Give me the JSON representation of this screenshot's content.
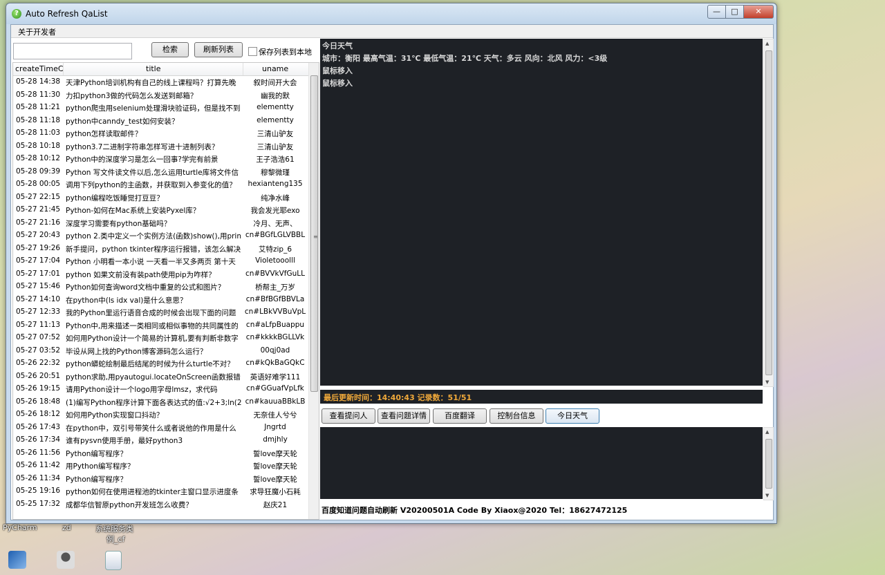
{
  "desktop": {
    "icon_labels": [
      "PyCharm",
      "zd",
      "系统服务类",
      "例_cf"
    ]
  },
  "window": {
    "title": "Auto Refresh QaList",
    "minimize": "—",
    "maximize": "□",
    "close": "✕"
  },
  "menu": {
    "about": "关于开发者"
  },
  "toolbar": {
    "search_value": "",
    "search_button": "检索",
    "refresh_button": "刷新列表",
    "save_checkbox_label": "保存列表到本地",
    "save_checked": false
  },
  "list": {
    "columns": [
      "createTimeC",
      "title",
      "uname"
    ],
    "rows": [
      {
        "time": "05-28 14:38",
        "title": "天津Python培训机构有自己的线上课程吗？打算先晚",
        "user": "叙时间开大会"
      },
      {
        "time": "05-28 11:30",
        "title": "力扣python3做的代码怎么发送到邮箱？",
        "user": "幽我的默"
      },
      {
        "time": "05-28 11:21",
        "title": "python爬虫用selenium处理滑块验证码，但是找不到",
        "user": "elementty"
      },
      {
        "time": "05-28 11:18",
        "title": "python中canndy_test如何安装？",
        "user": "elementty"
      },
      {
        "time": "05-28 11:03",
        "title": "python怎样读取邮件？",
        "user": "三清山驴友"
      },
      {
        "time": "05-28 10:18",
        "title": "python3.7二进制字符串怎样写进十进制列表？",
        "user": "三清山驴友"
      },
      {
        "time": "05-28 10:12",
        "title": "        Python中的深度学习是怎么一回事?学完有前景",
        "user": "王子浩浩61"
      },
      {
        "time": "05-28 09:39",
        "title": "Python 写文件读文件以后,怎么运用turtle库将文件信",
        "user": "穆黎微瑾"
      },
      {
        "time": "05-28 00:05",
        "title": "调用下列python的主函数，并获取到入参变化的值？",
        "user": "hexianteng135"
      },
      {
        "time": "05-27 22:15",
        "title": "python编程吃饭睡觉打豆豆？",
        "user": "纯净水峰"
      },
      {
        "time": "05-27 21:45",
        "title": "Python-如何在Mac系统上安装Pyxel库？",
        "user": "我会发光耶exo"
      },
      {
        "time": "05-27 21:16",
        "title": "深度学习需要有python基础吗？",
        "user": "冷月、无声、"
      },
      {
        "time": "05-27 20:43",
        "title": "python 2.类中定义一个实例方法(函数)show(),用print",
        "user": "cn#BGfLGLVBBL"
      },
      {
        "time": "05-27 19:26",
        "title": "新手提问，python tkinter程序运行报错，该怎么解决",
        "user": "艾特zip_6"
      },
      {
        "time": "05-27 17:04",
        "title": "Python 小明看一本小说 一天看一半又多两页 第十天",
        "user": "Violetooolll"
      },
      {
        "time": "05-27 17:01",
        "title": "python 如果文前没有装path使用pip为咋样？",
        "user": "cn#BVVkVfGuLL"
      },
      {
        "time": "05-27 15:46",
        "title": "Python如何查询word文档中重复的公式和图片？",
        "user": "桥帮主_万岁"
      },
      {
        "time": "05-27 14:10",
        "title": "在python中(ls idx val)是什么意思？",
        "user": "cn#BfBGfBBVLa"
      },
      {
        "time": "05-27 12:33",
        "title": "我的Python里运行语音合成的时候会出现下面的问题",
        "user": "cn#LBkVVBuVpL"
      },
      {
        "time": "05-27 11:13",
        "title": "Python中,用来描述一类相同或相似事物的共同属性的",
        "user": "cn#aLfpBuappu"
      },
      {
        "time": "05-27 07:52",
        "title": "如何用Python设计一个简易的计算机,要有判断非数字",
        "user": "cn#kkkkBGLLVk"
      },
      {
        "time": "05-27 03:52",
        "title": "毕设从网上找的Python博客源码怎么运行？",
        "user": "00qj0ad"
      },
      {
        "time": "05-26 22:32",
        "title": "python蟒蛇绘制最后结尾的时候为什么turtle不对？",
        "user": "cn#kQkBaGQkC"
      },
      {
        "time": "05-26 20:51",
        "title": "python求助,用pyautogui.locateOnScreen函数报错",
        "user": "英语好难学111"
      },
      {
        "time": "05-26 19:15",
        "title": "请用Python设计一个logo用字母lmsz，求代码",
        "user": "cn#GGuafVpLfk"
      },
      {
        "time": "05-26 18:48",
        "title": "(1)编写Python程序计算下面各表达式的值:√2+3;ln(2",
        "user": "cn#kauuaBBkLB"
      },
      {
        "time": "05-26 18:12",
        "title": "如何用Python实现窗口抖动？",
        "user": "无奈佳人兮兮"
      },
      {
        "time": "05-26 17:43",
        "title": "在python中，双引号带笑什么或者说他的作用是什么",
        "user": "Jngrtd"
      },
      {
        "time": "05-26 17:34",
        "title": "谁有pysvn使用手册，最好python3",
        "user": "dmjhly"
      },
      {
        "time": "05-26 11:56",
        "title": "Python编写程序？",
        "user": "誓love摩天轮"
      },
      {
        "time": "05-26 11:42",
        "title": "用Python编写程序？",
        "user": "誓love摩天轮"
      },
      {
        "time": "05-26 11:34",
        "title": "Python编写程序？",
        "user": "誓love摩天轮"
      },
      {
        "time": "05-25 19:16",
        "title": "python如何在使用进程池的tkinter主窗口显示进度条",
        "user": "求导狂魔小石耗"
      },
      {
        "time": "05-25 17:32",
        "title": "成都华信智原python开发班怎么收费？",
        "user": "赵庆21"
      }
    ]
  },
  "console": {
    "lines": [
      "今日天气",
      "城市：衡阳 最高气温：31℃ 最低气温：21℃ 天气：多云 风向：北风 风力：<3级",
      "鼠标移入",
      "鼠标移入"
    ]
  },
  "status": {
    "text": "最后更新时间：14:40:43  记录数：51/51"
  },
  "actions": {
    "view_asker": "查看提问人",
    "view_detail": "查看问题详情",
    "baidu_translate": "百度翻译",
    "console_info": "控制台信息",
    "today_weather": "今日天气"
  },
  "footer": {
    "text": "百度知道问题自动刷新 V20200501A Code By Xiaox@2020 Tel：18627472125"
  },
  "colors": {
    "console_bg": "#1e2126",
    "status_text": "#f0a93a"
  }
}
